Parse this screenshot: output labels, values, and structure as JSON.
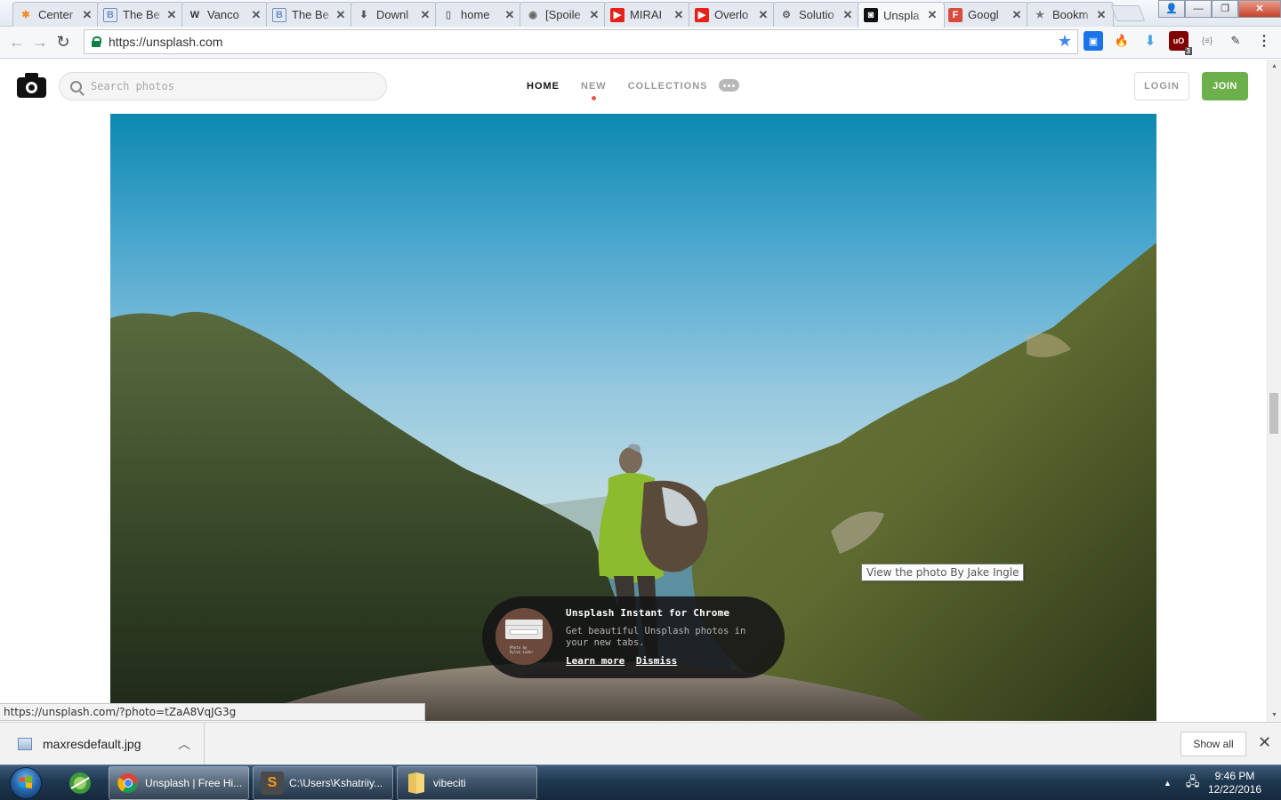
{
  "browser": {
    "tabs": [
      {
        "title": "Center",
        "favicon": "asterisk-icon",
        "color": "#f28c28"
      },
      {
        "title": "The Be",
        "favicon": "blogger-b-icon",
        "color": "#6a8fc7"
      },
      {
        "title": "Vanco",
        "favicon": "w-icon",
        "color": "#333333"
      },
      {
        "title": "The Be",
        "favicon": "blogger-b-icon",
        "color": "#6a8fc7"
      },
      {
        "title": "Downl",
        "favicon": "download-icon",
        "color": "#555555"
      },
      {
        "title": "home",
        "favicon": "page-icon",
        "color": "#777777"
      },
      {
        "title": "[Spoile",
        "favicon": "reddit-icon",
        "color": "#666666"
      },
      {
        "title": "MIRAI",
        "favicon": "youtube-icon",
        "color": "#e62117"
      },
      {
        "title": "Overlo",
        "favicon": "youtube-icon",
        "color": "#e62117"
      },
      {
        "title": "Solutio",
        "favicon": "gear-icon",
        "color": "#666666"
      },
      {
        "title": "Unspla",
        "favicon": "camera-icon",
        "color": "#111111",
        "active": true
      },
      {
        "title": "Googl",
        "favicon": "f-icon",
        "color": "#d94c3d"
      },
      {
        "title": "Bookm",
        "favicon": "star-icon",
        "color": "#777777"
      }
    ],
    "url": "https://unsplash.com",
    "status_url": "https://unsplash.com/?photo=tZaA8VqJG3g",
    "extensions": [
      "screen-icon",
      "fire-icon",
      "down-arrow-icon",
      "ublock-icon",
      "json-icon",
      "tools-icon",
      "menu-icon"
    ],
    "ublock_badge": "3",
    "json_label": "{≡}"
  },
  "unsplash": {
    "search_placeholder": "Search photos",
    "nav": {
      "home": "HOME",
      "new": "NEW",
      "collections": "COLLECTIONS"
    },
    "login": "LOGIN",
    "join": "JOIN",
    "tooltip": "View the photo By Jake Ingle",
    "promo": {
      "title": "Unsplash Instant for Chrome",
      "text": "Get beautiful Unsplash photos in your new tabs.",
      "learn_more": "Learn more",
      "dismiss": "Dismiss",
      "thumb_caption_1": "Photo by",
      "thumb_caption_2": "Dylan Luder"
    },
    "brand_green": "#6bb04a",
    "new_dot_color": "#e25b4a"
  },
  "downloads": {
    "file": "maxresdefault.jpg",
    "show_all": "Show all"
  },
  "taskbar": {
    "buttons": [
      {
        "label": "Unsplash | Free Hi...",
        "icon": "chrome-icon"
      },
      {
        "label": "C:\\Users\\Kshatriiy...",
        "icon": "sublime-icon"
      },
      {
        "label": "vibeciti",
        "icon": "folder-icon"
      }
    ],
    "time": "9:46 PM",
    "date": "12/22/2016"
  }
}
